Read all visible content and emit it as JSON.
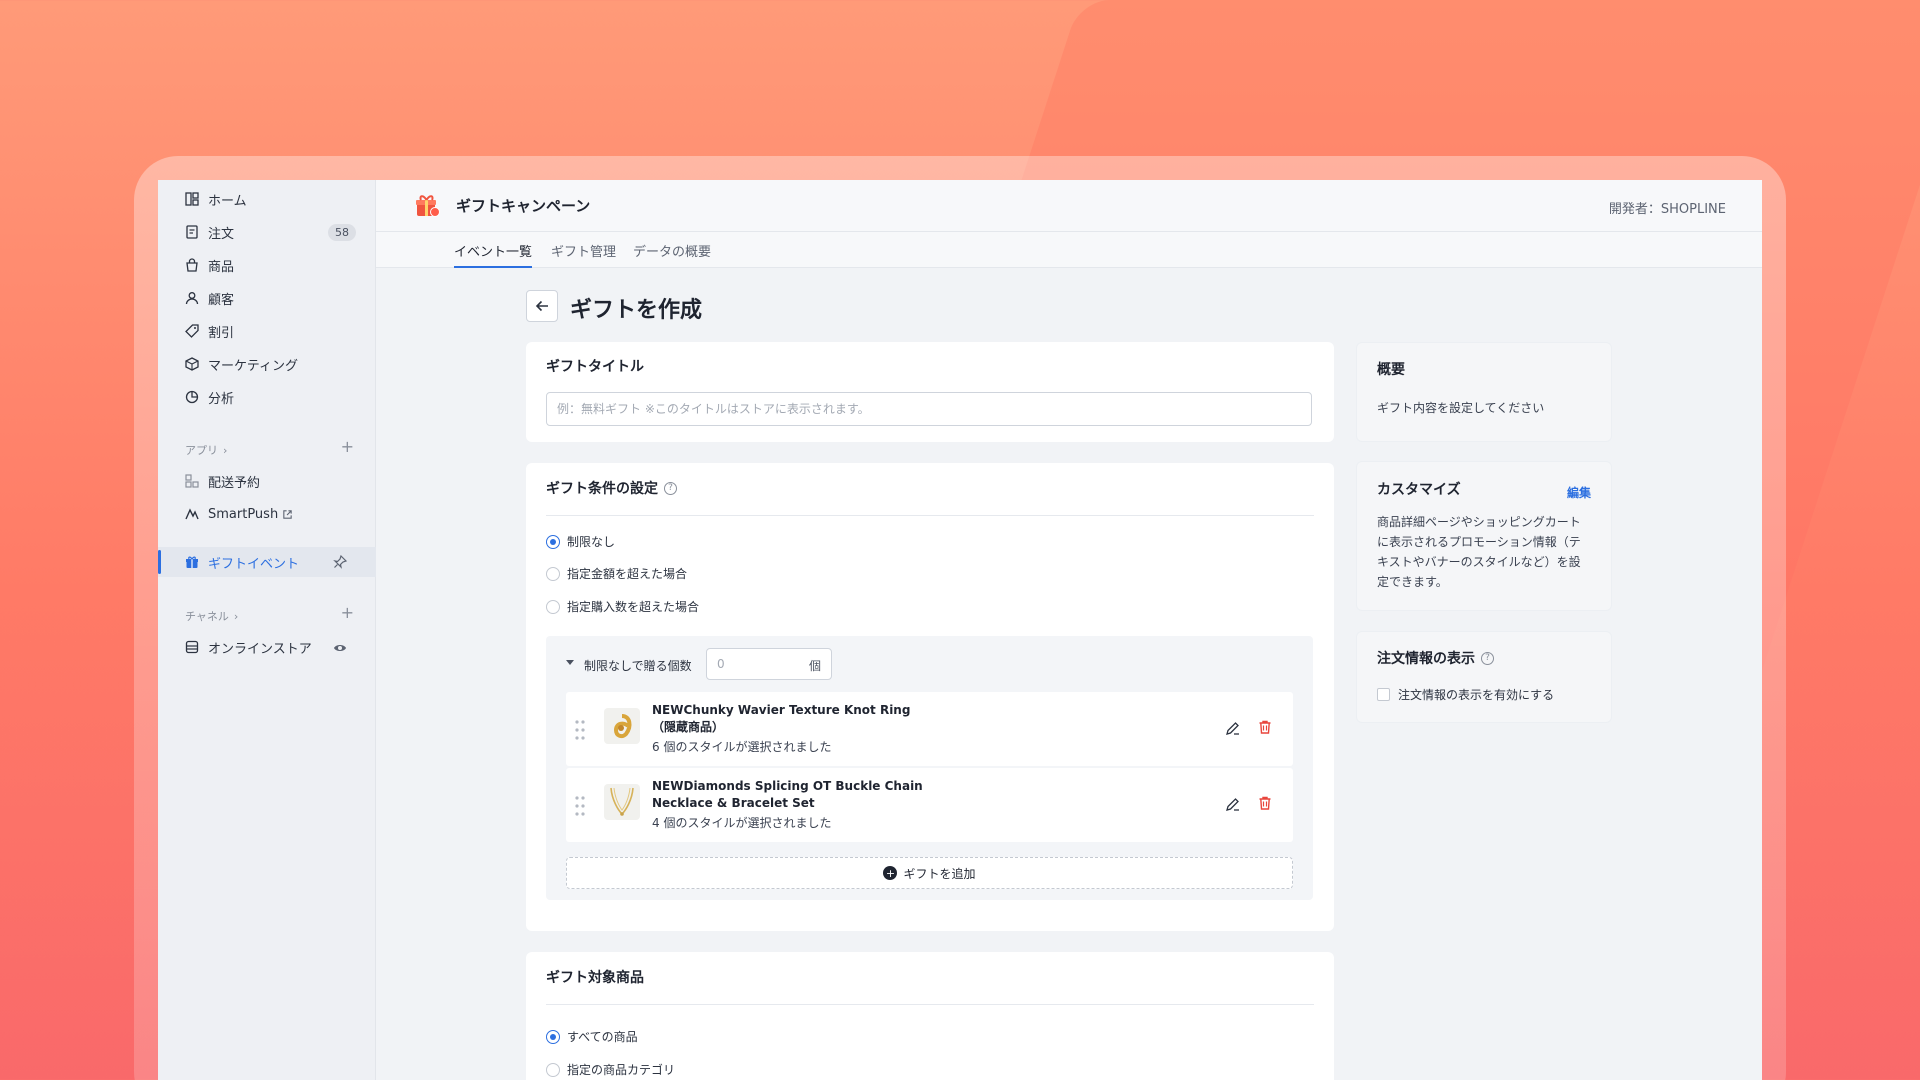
{
  "sidebar": {
    "items": [
      {
        "label": "ホーム",
        "icon": "home-icon"
      },
      {
        "label": "注文",
        "icon": "orders-icon",
        "badge": "58"
      },
      {
        "label": "商品",
        "icon": "products-icon"
      },
      {
        "label": "顧客",
        "icon": "customers-icon"
      },
      {
        "label": "割引",
        "icon": "discount-icon"
      },
      {
        "label": "マーケティング",
        "icon": "marketing-icon"
      },
      {
        "label": "分析",
        "icon": "analytics-icon"
      }
    ],
    "apps_label": "アプリ",
    "apps": [
      {
        "label": "配送予約",
        "icon": "delivery-icon"
      },
      {
        "label": "SmartPush",
        "icon": "smartpush-icon"
      }
    ],
    "active_item": {
      "label": "ギフトイベント",
      "icon": "gift-icon"
    },
    "channels_label": "チャネル",
    "channels": [
      {
        "label": "オンラインストア",
        "icon": "store-icon"
      }
    ]
  },
  "header": {
    "app_title": "ギフトキャンペーン",
    "developer": "開発者：SHOPLINE"
  },
  "tabs": [
    {
      "label": "イベント一覧",
      "active": true
    },
    {
      "label": "ギフト管理",
      "active": false
    },
    {
      "label": "データの概要",
      "active": false
    }
  ],
  "page": {
    "title": "ギフトを作成"
  },
  "gift_title_card": {
    "title": "ギフトタイトル",
    "placeholder": "例：無料ギフト ※このタイトルはストアに表示されます。"
  },
  "conditions_card": {
    "title": "ギフト条件の設定",
    "options": [
      "制限なし",
      "指定金額を超えた場合",
      "指定購入数を超えた場合"
    ],
    "selected": 0,
    "count_label": "制限なしで贈る個数",
    "count_value": "0",
    "count_unit": "個",
    "gifts": [
      {
        "name": "NEWChunky Wavier Texture Knot Ring（隠蔵商品）",
        "styles": "6 個のスタイルが選択されました"
      },
      {
        "name": "NEWDiamonds Splicing OT Buckle Chain Necklace & Bracelet Set",
        "styles": "4 個のスタイルが選択されました"
      }
    ],
    "add_label": "ギフトを追加"
  },
  "target_card": {
    "title": "ギフト対象商品",
    "options": [
      "すべての商品",
      "指定の商品カテゴリ"
    ],
    "selected": 0
  },
  "summary_card": {
    "title": "概要",
    "text": "ギフト内容を設定してください"
  },
  "customize_card": {
    "title": "カスタマイズ",
    "edit_label": "編集",
    "text": "商品詳細ページやショッピングカートに表示されるプロモーション情報（テキストやバナーのスタイルなど）を設定できます。"
  },
  "order_info_card": {
    "title": "注文情報の表示",
    "checkbox_label": "注文情報の表示を有効にする"
  },
  "colors": {
    "accent": "#2c6fe0",
    "danger": "#e8453c",
    "background": "#ff7a66"
  }
}
